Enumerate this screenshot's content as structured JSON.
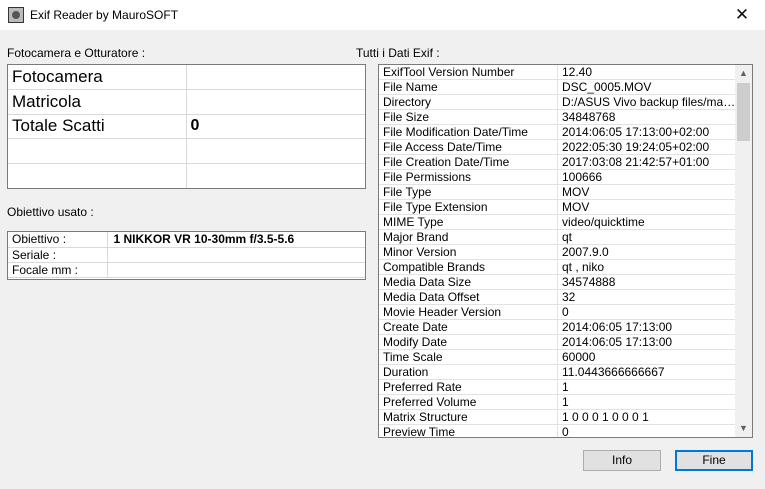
{
  "window": {
    "title": "Exif Reader by MauroSOFT",
    "close_glyph": "✕"
  },
  "camera_section": {
    "label": "Fotocamera e Otturatore :",
    "rows": [
      {
        "label": "Fotocamera",
        "value": ""
      },
      {
        "label": "Matricola",
        "value": ""
      },
      {
        "label": "Totale Scatti",
        "value": "0"
      },
      {
        "label": "",
        "value": ""
      },
      {
        "label": "",
        "value": ""
      }
    ]
  },
  "lens_section": {
    "label": "Obiettivo usato :",
    "rows": [
      {
        "label": "Obiettivo :",
        "value": "1 NIKKOR VR 10-30mm f/3.5-5.6"
      },
      {
        "label": "Seriale :",
        "value": ""
      },
      {
        "label": "Focale mm :",
        "value": ""
      }
    ]
  },
  "exif_section": {
    "label": "Tutti i Dati Exif :",
    "rows": [
      {
        "key": "ExifTool Version Number",
        "value": "12.40"
      },
      {
        "key": "File Name",
        "value": "DSC_0005.MOV"
      },
      {
        "key": "Directory",
        "value": "D:/ASUS Vivo backup files/mas..."
      },
      {
        "key": "File Size",
        "value": "34848768"
      },
      {
        "key": "File Modification Date/Time",
        "value": "2014:06:05 17:13:00+02:00"
      },
      {
        "key": "File Access Date/Time",
        "value": "2022:05:30 19:24:05+02:00"
      },
      {
        "key": "File Creation Date/Time",
        "value": "2017:03:08 21:42:57+01:00"
      },
      {
        "key": "File Permissions",
        "value": "100666"
      },
      {
        "key": "File Type",
        "value": "MOV"
      },
      {
        "key": "File Type Extension",
        "value": "MOV"
      },
      {
        "key": "MIME Type",
        "value": "video/quicktime"
      },
      {
        "key": "Major Brand",
        "value": "qt"
      },
      {
        "key": "Minor Version",
        "value": "2007.9.0"
      },
      {
        "key": "Compatible Brands",
        "value": "qt  , niko"
      },
      {
        "key": "Media Data Size",
        "value": "34574888"
      },
      {
        "key": "Media Data Offset",
        "value": "32"
      },
      {
        "key": "Movie Header Version",
        "value": "0"
      },
      {
        "key": "Create Date",
        "value": "2014:06:05 17:13:00"
      },
      {
        "key": "Modify Date",
        "value": "2014:06:05 17:13:00"
      },
      {
        "key": "Time Scale",
        "value": "60000"
      },
      {
        "key": "Duration",
        "value": "11.0443666666667"
      },
      {
        "key": "Preferred Rate",
        "value": "1"
      },
      {
        "key": "Preferred Volume",
        "value": "1"
      },
      {
        "key": "Matrix Structure",
        "value": "1 0 0 0 1 0 0 0 1"
      },
      {
        "key": "Preview Time",
        "value": "0"
      }
    ]
  },
  "buttons": {
    "info": "Info",
    "fine": "Fine"
  },
  "scroll": {
    "up_glyph": "▲",
    "down_glyph": "▼"
  }
}
